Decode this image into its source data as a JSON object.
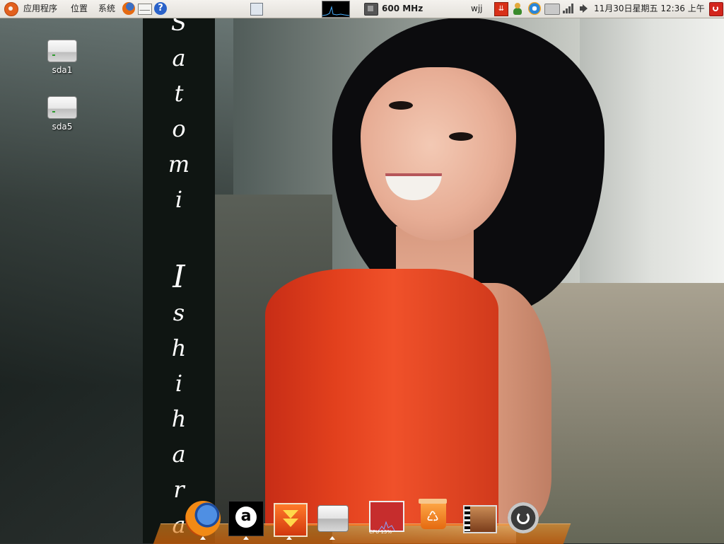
{
  "top_panel": {
    "menus": [
      {
        "label": "应用程序"
      },
      {
        "label": "位置"
      },
      {
        "label": "系统"
      }
    ],
    "launchers": [
      {
        "icon": "firefox-icon"
      },
      {
        "icon": "mail-icon"
      },
      {
        "icon": "help-icon"
      }
    ],
    "cpu_freq": "600 MHz",
    "user": "wjj",
    "clock": "11月30日星期五 12:36 上午"
  },
  "desktop": {
    "icons": [
      {
        "label": "sda1",
        "icon": "drive-icon"
      },
      {
        "label": "sda5",
        "icon": "drive-icon"
      }
    ]
  },
  "banner": {
    "first": [
      "S",
      "a",
      "t",
      "o",
      "m",
      "i"
    ],
    "last": [
      "I",
      "s",
      "h",
      "i",
      "h",
      "a",
      "r",
      "a"
    ]
  },
  "dock": {
    "items": [
      {
        "icon": "firefox-icon"
      },
      {
        "icon": "amarok-icon"
      },
      {
        "icon": "download-icon"
      },
      {
        "icon": "drive-icon"
      },
      {
        "icon": "cpu-monitor-icon",
        "label": "CPU 13%"
      },
      {
        "icon": "trash-icon"
      },
      {
        "icon": "video-icon"
      },
      {
        "icon": "power-icon"
      }
    ]
  },
  "colors": {
    "panel_top": "#f4f2ee",
    "panel_bottom": "#e3e0da",
    "ubuntu_orange": "#e2601e",
    "dock_orange": "#e07818",
    "dress_red": "#e2401d"
  }
}
